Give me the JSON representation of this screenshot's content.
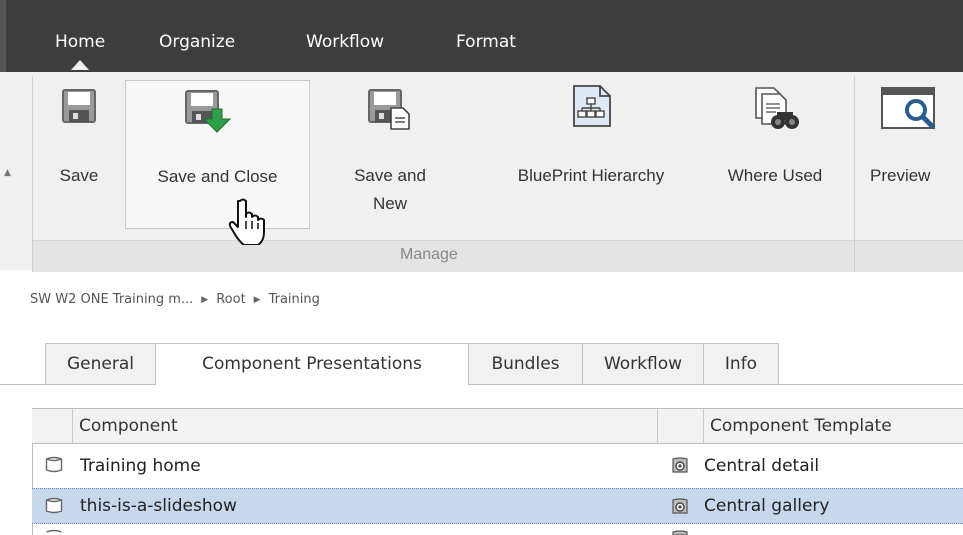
{
  "menu": {
    "tabs": [
      "Home",
      "Organize",
      "Workflow",
      "Format"
    ],
    "active": "Home"
  },
  "ribbon": {
    "buttons": {
      "save": "Save",
      "save_and_close": "Save and Close",
      "save_and_new_line1": "Save and",
      "save_and_new_line2": "New",
      "blueprint_hierarchy": "BluePrint Hierarchy",
      "where_used": "Where Used",
      "preview": "Preview"
    },
    "group_label": "Manage"
  },
  "breadcrumb": [
    "SW W2 ONE Training m...",
    "Root",
    "Training"
  ],
  "tabs": [
    "General",
    "Component Presentations",
    "Bundles",
    "Workflow",
    "Info"
  ],
  "active_tab": "Component Presentations",
  "table": {
    "columns": [
      "Component",
      "Component Template"
    ],
    "rows": [
      {
        "component": "Training home",
        "template": "Central detail",
        "selected": false
      },
      {
        "component": "this-is-a-slideshow",
        "template": "Central gallery",
        "selected": true
      }
    ]
  },
  "colors": {
    "menubar": "#3d3d3d",
    "ribbon": "#f0f0f0",
    "selected_row": "#c7d7ec",
    "save_close_arrow": "#2e9e48"
  },
  "icons": [
    "floppy-disk-icon",
    "save-close-icon",
    "save-new-icon",
    "blueprint-hierarchy-icon",
    "where-used-icon",
    "preview-icon",
    "hand-cursor-icon",
    "component-icon",
    "component-template-icon"
  ]
}
